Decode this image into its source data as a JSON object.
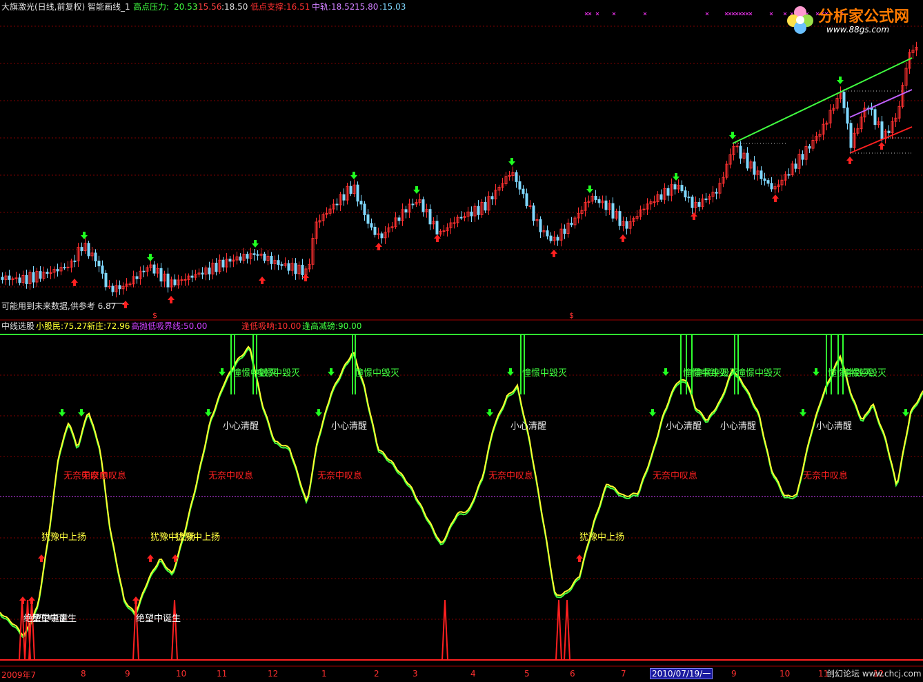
{
  "top_panel": {
    "title": "大旗激光(日线,前复权) 智能画线_1",
    "resist_label": "高点压力:",
    "resist_v1": "20.53",
    "resist_v2": ":15.56",
    "resist_v3": ":18.50",
    "support_label": "低点支撑:",
    "support_v1": "16.51",
    "mid_label": "中轨:",
    "mid_v1": "18.52",
    "mid_v2": ":15.80",
    "mid_v3": ":15.03",
    "future_note": "可能用到未来数据,供参考 6.87"
  },
  "bottom_panel": {
    "title": "中线选股",
    "small_investor": "小股民:75.27",
    "new_dealer": "新庄:72.96",
    "threshold": "高抛低吸界线:50.00",
    "low_absorb": "逢低吸呐:10.00",
    "high_reduce": "逢高减磅:90.00",
    "labels": {
      "destroy": "憧憬中毁灭",
      "alert": "小心清醒",
      "sigh": "无奈中叹息",
      "hesitate": "犹豫中上扬",
      "birth": "绝望中诞生"
    }
  },
  "x_axis": {
    "months": [
      "2009年7",
      "8",
      "9",
      "10",
      "11",
      "12",
      "1",
      "2",
      "3",
      "4",
      "5",
      "6",
      "7",
      "9",
      "10",
      "11",
      "12"
    ],
    "cursor_date": "2010/07/19/一"
  },
  "watermark": {
    "site_name": "分析家公式网",
    "site_url": "www.88gs.com",
    "footer": "创幻论坛 www.chcj.com"
  },
  "colors": {
    "rise": "#ff3030",
    "fall": "#7fd8ff",
    "resist_line": "#40ff40",
    "mid_line": "#c060ff",
    "support_line": "#ff2020",
    "osc_a": "#ffff30",
    "osc_b": "#40ff40",
    "grid": "#800000"
  }
}
